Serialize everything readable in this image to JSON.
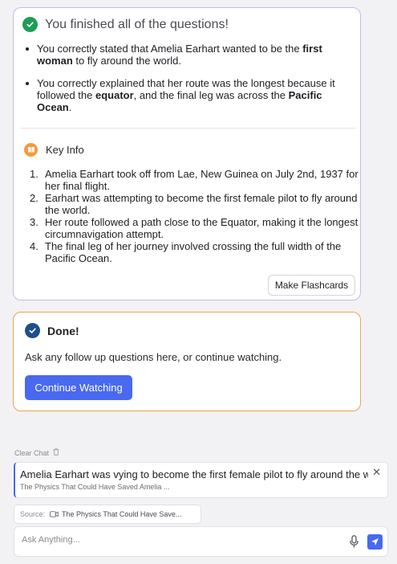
{
  "summary_card": {
    "title": "You finished all of the questions!",
    "bullets": [
      [
        "You correctly stated that Amelia Earhart wanted to be the ",
        "first woman",
        " to fly around the world."
      ],
      [
        "You correctly explained that her route was the longest because it followed the ",
        "equator",
        ", and the final leg was across the ",
        "Pacific Ocean",
        "."
      ]
    ],
    "key_info_label": "Key Info",
    "key_info": [
      "Amelia Earhart took off from Lae, New Guinea on July 2nd, 1937 for her final flight.",
      "Earhart was attempting to become the first female pilot to fly around the world.",
      "Her route followed a path close to the Equator, making it the longest circumnavigation attempt.",
      "The final leg of her journey involved crossing the full width of the Pacific Ocean."
    ],
    "flashcards_button": "Make Flashcards"
  },
  "done_card": {
    "title": "Done!",
    "message": "Ask any follow up questions here, or continue watching.",
    "continue_button": "Continue Watching"
  },
  "chat": {
    "clear_label": "Clear Chat",
    "query_text": "Amelia Earhart was vying to become the first female pilot to fly around the world",
    "query_source": "The Physics That Could Have Saved Amelia ...",
    "source_label": "Source:",
    "source_title": "The Physics That Could Have Save...",
    "input_placeholder": "Ask Anything..."
  },
  "colors": {
    "accent": "#4869f0",
    "success": "#1f9d55",
    "summary_border": "#cdb6ec",
    "done_border": "#f0a34c",
    "key_info_icon": "#f59a3b"
  },
  "icons": [
    "check-circle-icon",
    "book-icon",
    "check-badge-icon",
    "trash-icon",
    "close-icon",
    "video-icon",
    "mic-icon",
    "send-icon"
  ]
}
